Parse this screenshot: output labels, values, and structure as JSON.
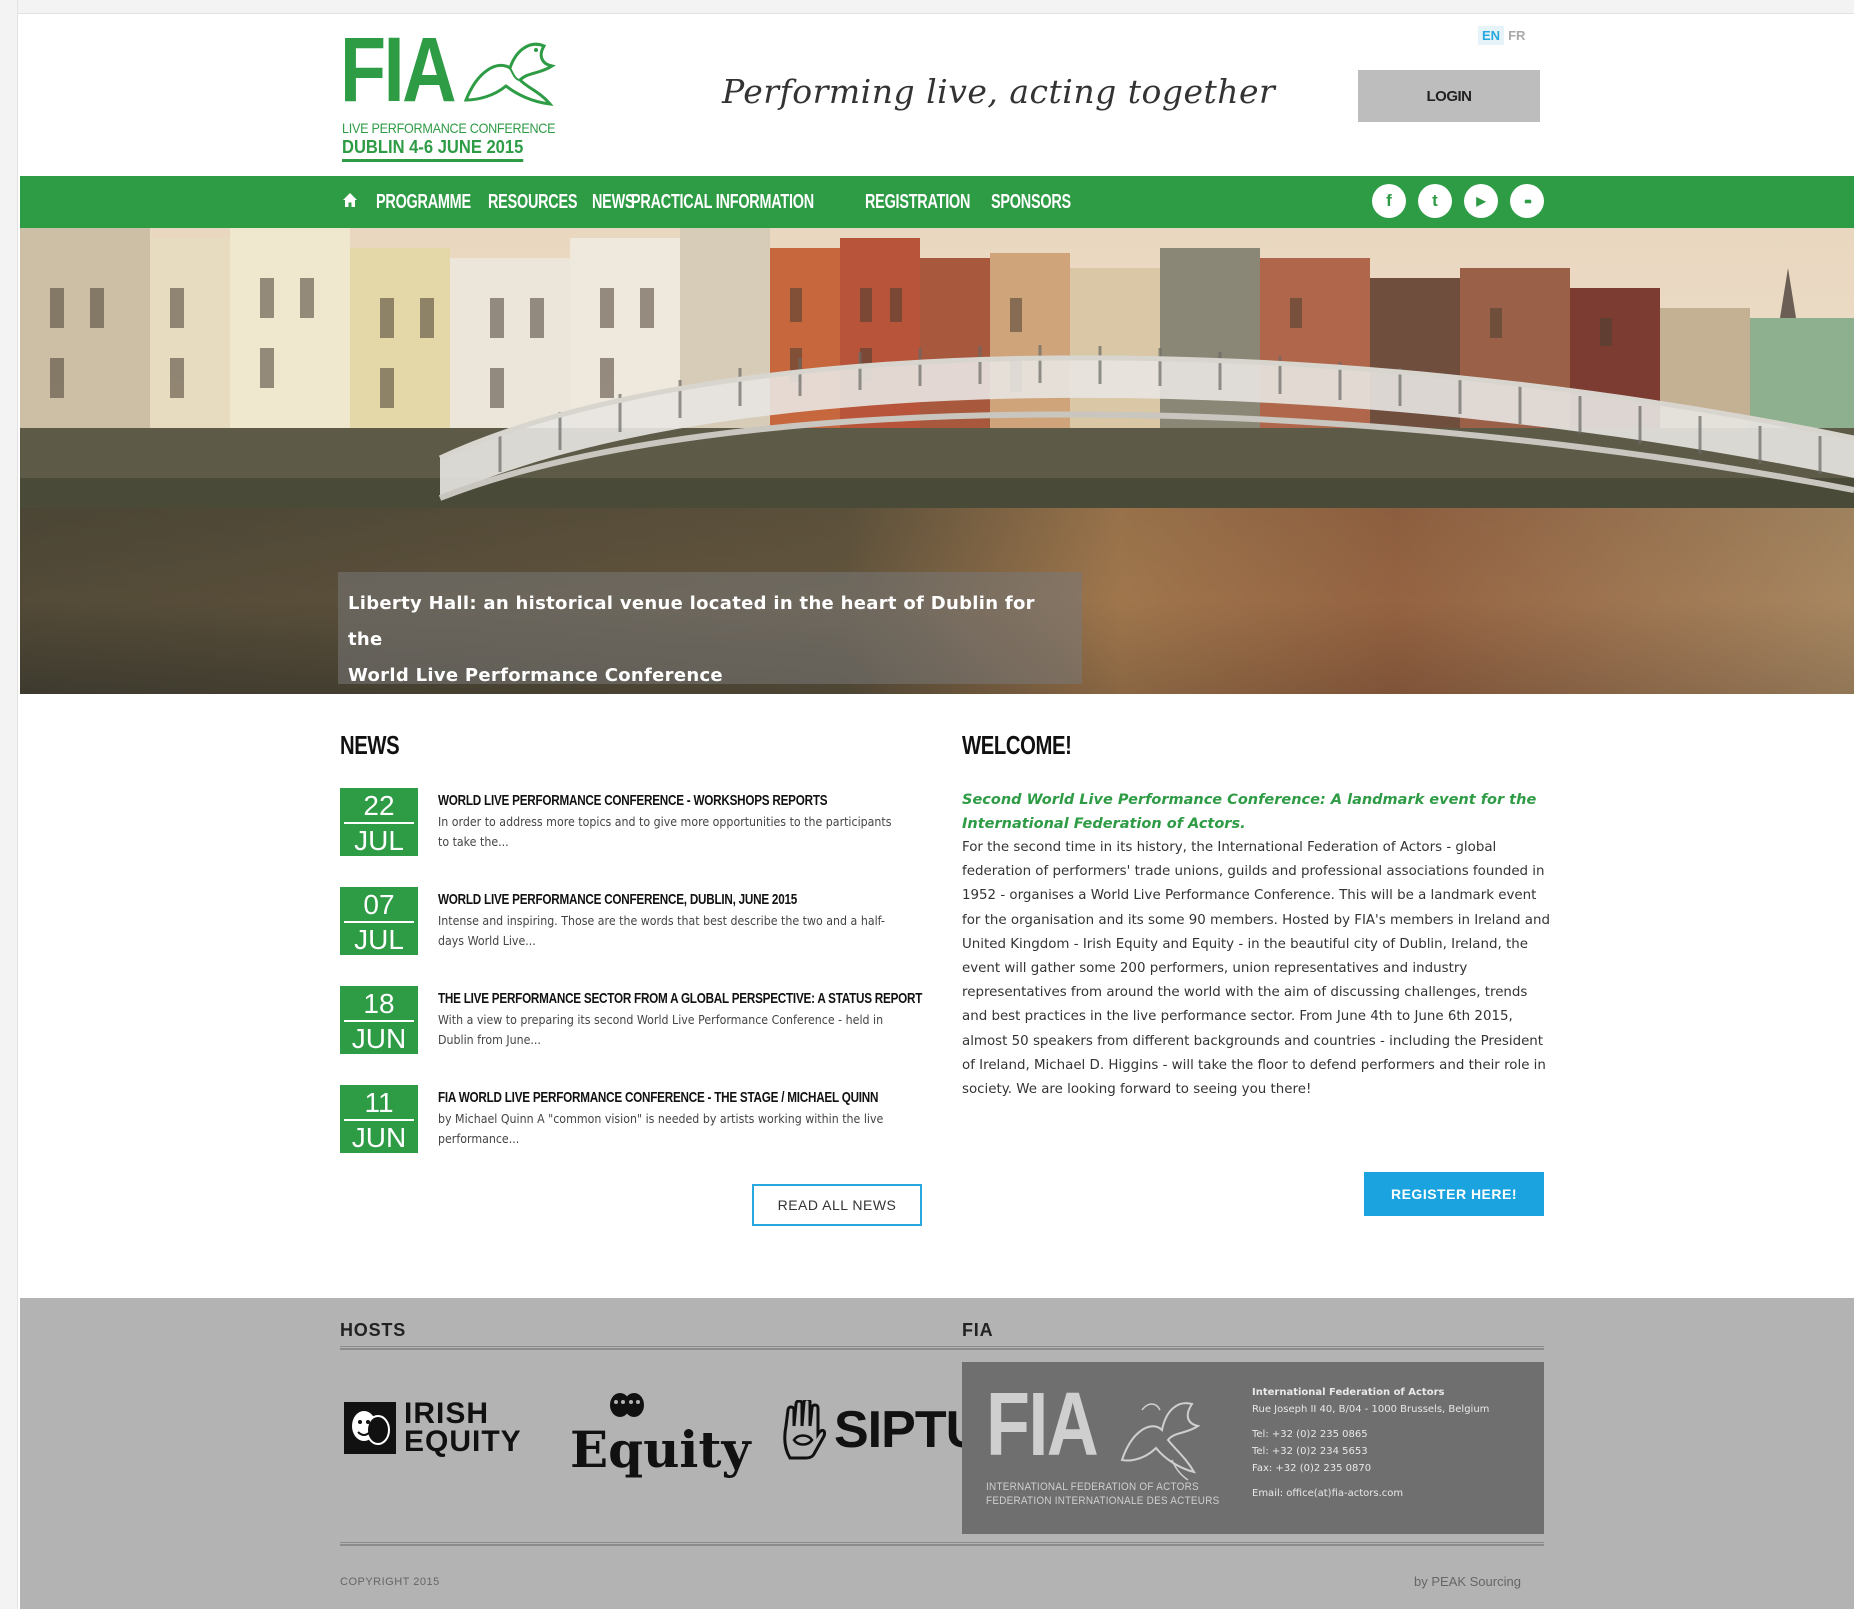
{
  "header": {
    "logo_text": "FIA",
    "logo_subtitle": "LIVE PERFORMANCE CONFERENCE",
    "logo_date": "DUBLIN 4-6 JUNE 2015",
    "tagline": "Performing live, acting together",
    "lang_en": "EN",
    "lang_fr": "FR",
    "login_label": "LOGIN"
  },
  "nav": {
    "items": [
      {
        "label": "PROGRAMME"
      },
      {
        "label": "RESOURCES"
      },
      {
        "label": "NEWS"
      },
      {
        "label": "PRACTICAL INFORMATION"
      },
      {
        "label": "REGISTRATION"
      },
      {
        "label": "SPONSORS"
      }
    ],
    "social": [
      {
        "icon": "facebook-icon",
        "glyph": "f"
      },
      {
        "icon": "twitter-icon",
        "glyph": "t"
      },
      {
        "icon": "youtube-icon",
        "glyph": "▶"
      },
      {
        "icon": "flickr-icon",
        "glyph": "••"
      }
    ]
  },
  "hero": {
    "caption_line1": "Liberty Hall: an historical venue located in the heart of Dublin for the",
    "caption_line2": "World Live Performance Conference"
  },
  "news": {
    "title": "NEWS",
    "items": [
      {
        "day": "22",
        "month": "JUL",
        "title": "WORLD LIVE PERFORMANCE CONFERENCE - WORKSHOPS REPORTS",
        "excerpt": "In order to address more topics and to give more opportunities to the participants to take the..."
      },
      {
        "day": "07",
        "month": "JUL",
        "title": "WORLD LIVE PERFORMANCE CONFERENCE, DUBLIN, JUNE 2015",
        "excerpt": "Intense and inspiring. Those are the words that best describe the two and a half-days World Live..."
      },
      {
        "day": "18",
        "month": "JUN",
        "title": "THE LIVE PERFORMANCE SECTOR FROM A GLOBAL PERSPECTIVE: A STATUS REPORT",
        "excerpt": "With a view to preparing its second World Live Performance Conference - held in Dublin from June..."
      },
      {
        "day": "11",
        "month": "JUN",
        "title": "FIA WORLD LIVE PERFORMANCE CONFERENCE - THE STAGE / MICHAEL QUINN",
        "excerpt": " by Michael Quinn A \"common vision\" is needed by artists working within the live performance..."
      }
    ],
    "read_all_label": "READ ALL NEWS"
  },
  "welcome": {
    "title": "WELCOME!",
    "subtitle": "Second World Live Performance Conference: A landmark event for the International Federation of Actors.",
    "body": "For the second time in its history, the International Federation of Actors - global federation of performers' trade unions, guilds and professional associations founded in 1952 - organises a World Live Performance Conference. This will be a landmark event for the organisation and its some 90 members. Hosted by FIA's members in Ireland and United Kingdom - Irish Equity and Equity - in the beautiful city of Dublin, Ireland, the event will gather some 200 performers, union representatives and industry representatives from around the world with the aim of discussing challenges, trends and best practices in the live performance sector. From June 4th to June 6th 2015, almost 50 speakers from different backgrounds and countries - including the President of Ireland, Michael D. Higgins - will take the floor to defend performers and their role in society. We are looking forward to seeing you there!",
    "register_label": "REGISTER HERE!"
  },
  "footer": {
    "hosts_title": "HOSTS",
    "fia_title": "FIA",
    "hosts": [
      {
        "line1": "IRISH",
        "line2": "EQUITY"
      },
      {
        "name": "Equity"
      },
      {
        "name": "SIPTU"
      }
    ],
    "fia_logo_text": "FIA",
    "fia_full_en": "INTERNATIONAL FEDERATION OF ACTORS",
    "fia_full_fr": "FEDERATION INTERNATIONALE DES ACTEURS",
    "fia_org": "International Federation of Actors",
    "fia_address": "Rue Joseph II 40, B/04 - 1000 Brussels, Belgium",
    "fia_tel1": "Tel: +32 (0)2 235 0865",
    "fia_tel2": "Tel: +32 (0)2 234 5653",
    "fia_fax": "Fax: +32 (0)2 235 0870",
    "fia_email": "Email: office(at)fia-actors.com",
    "copyright": "COPYRIGHT 2015",
    "credit": "by PEAK Sourcing"
  },
  "colors": {
    "brand_green": "#2e9b45",
    "accent_blue": "#1aa3df",
    "footer_gray": "#b3b3b3"
  }
}
